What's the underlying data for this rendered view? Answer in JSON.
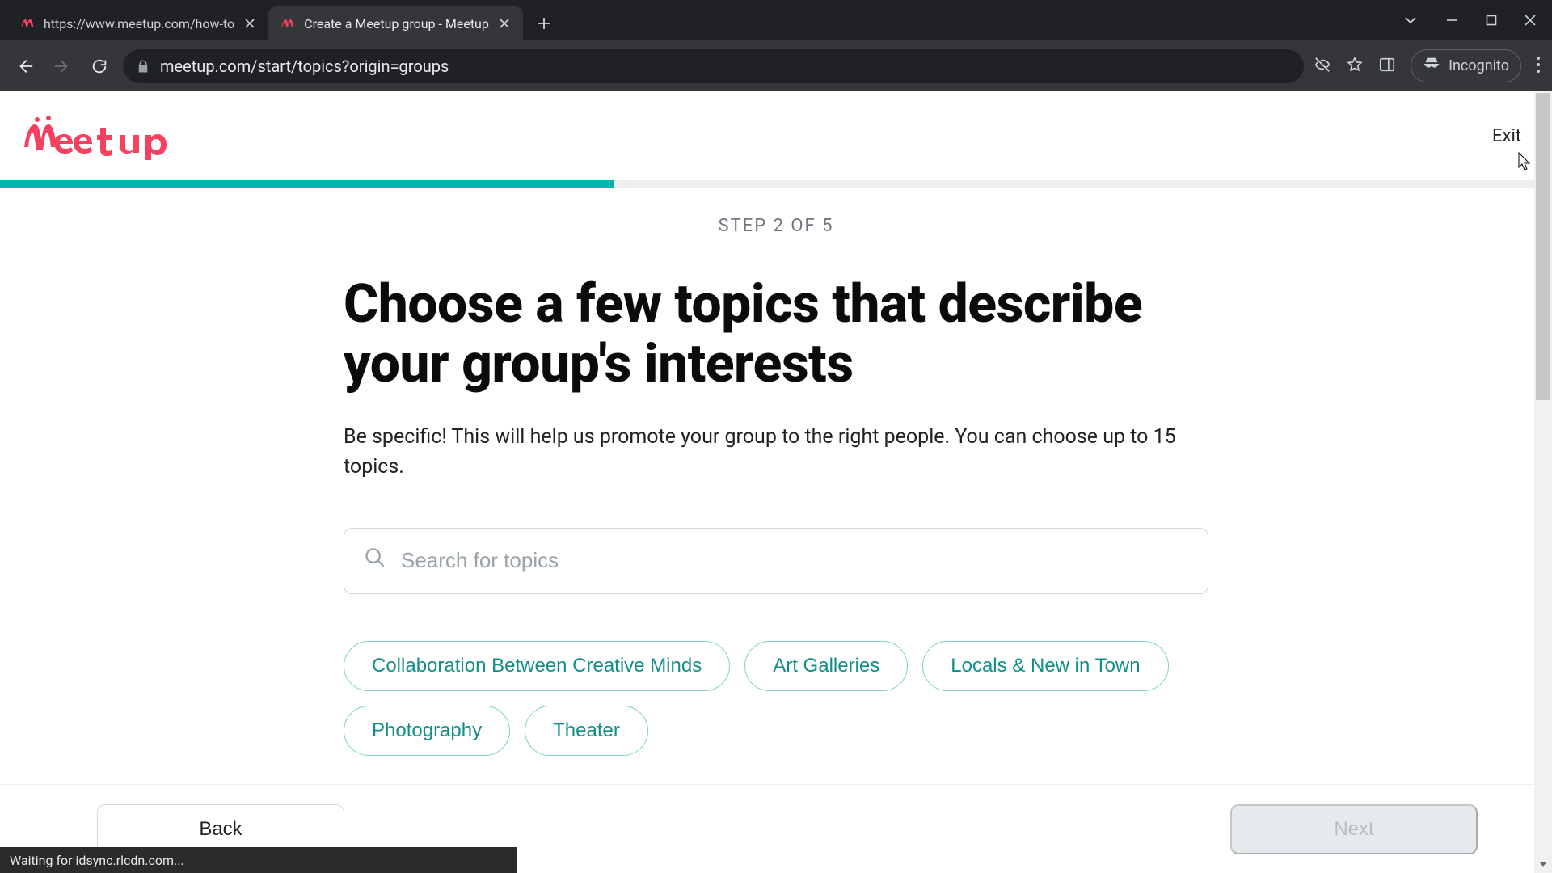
{
  "browser": {
    "tabs": [
      {
        "title": "https://www.meetup.com/how-to",
        "active": false
      },
      {
        "title": "Create a Meetup group - Meetup",
        "active": true
      }
    ],
    "url": "meetup.com/start/topics?origin=groups",
    "incognito_label": "Incognito"
  },
  "header": {
    "exit_label": "Exit"
  },
  "progress": {
    "percent": 40
  },
  "main": {
    "step_label": "STEP 2 OF 5",
    "headline": "Choose a few topics that describe your group's interests",
    "sub": "Be specific! This will help us promote your group to the right people. You can choose up to 15 topics.",
    "search_placeholder": "Search for topics",
    "chips": [
      "Collaboration Between Creative Minds",
      "Art Galleries",
      "Locals & New in Town",
      "Photography",
      "Theater"
    ]
  },
  "footer": {
    "back_label": "Back",
    "next_label": "Next"
  },
  "status": {
    "text": "Waiting for idsync.rlcdn.com..."
  }
}
